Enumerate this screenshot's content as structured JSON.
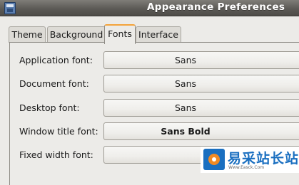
{
  "window": {
    "title": "Appearance Preferences",
    "icon": "window-app-icon"
  },
  "tabs": [
    {
      "label": "Theme",
      "active": false
    },
    {
      "label": "Background",
      "active": false
    },
    {
      "label": "Fonts",
      "active": true
    },
    {
      "label": "Interface",
      "active": false
    }
  ],
  "fonts": {
    "application": {
      "label": "Application font:",
      "value": "Sans"
    },
    "document": {
      "label": "Document font:",
      "value": "Sans"
    },
    "desktop": {
      "label": "Desktop font:",
      "value": "Sans"
    },
    "window_title": {
      "label": "Window title font:",
      "value": "Sans Bold"
    },
    "fixed_width": {
      "label": "Fixed width font:",
      "value": ""
    }
  },
  "watermark": {
    "text": "易采站长站",
    "subtext": "Www.Easck.Com"
  },
  "colors": {
    "titlebar": "#5c5a56",
    "active_tab_accent": "#f4a33a",
    "background": "#ecebe8",
    "watermark_blue": "#1a6fc0"
  }
}
